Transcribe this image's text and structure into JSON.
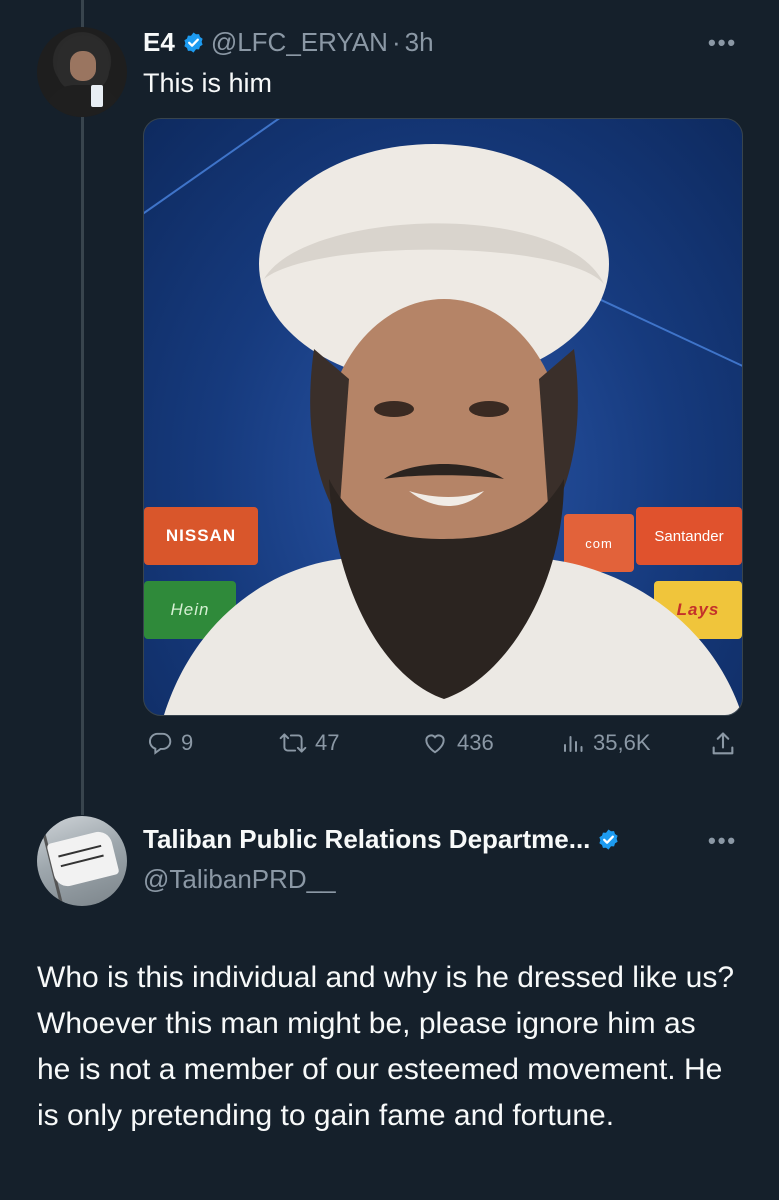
{
  "tweet1": {
    "name": "E4",
    "handle": "@LFC_ERYAN",
    "separator": "·",
    "time": "3h",
    "text": "This is him",
    "media_ads": {
      "nissan": "NISSAN",
      "heineken": "Hein",
      "com": "com",
      "santander": "Santander",
      "lays": "Lays"
    },
    "replies": "9",
    "retweets": "47",
    "likes": "436",
    "views": "35,6K"
  },
  "tweet2": {
    "name": "Taliban Public Relations Departme...",
    "handle": "@TalibanPRD__",
    "text": "Who is this individual and why is he dressed like us? Whoever this man might be, please ignore him as he is not a member of our esteemed movement. He is only pretending to gain fame and fortune."
  },
  "colors": {
    "background": "#15202b",
    "verified": "#1d9bf0",
    "muted": "#8b98a5"
  },
  "icons": [
    "verified-badge-icon",
    "more-icon",
    "reply-icon",
    "retweet-icon",
    "like-icon",
    "views-icon",
    "share-icon"
  ]
}
